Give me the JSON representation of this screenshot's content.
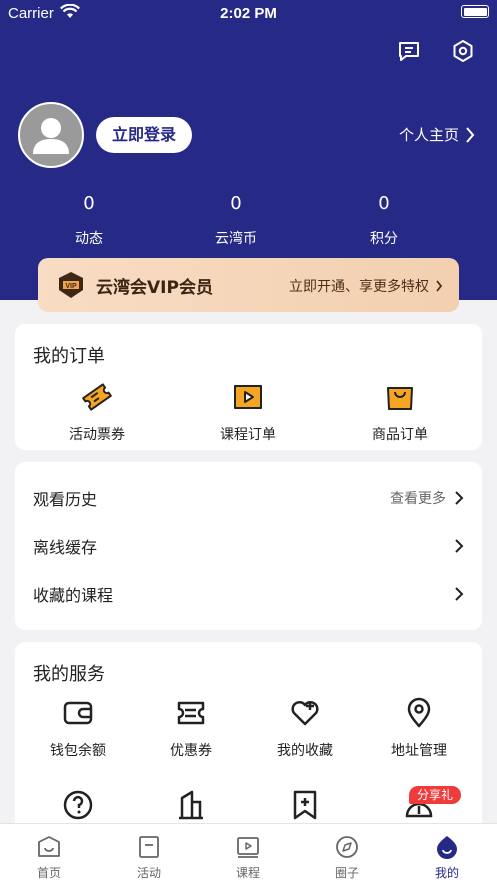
{
  "status_bar": {
    "carrier": "Carrier",
    "time": "2:02 PM"
  },
  "header": {
    "login_label": "立即登录",
    "profile_label": "个人主页",
    "stats": [
      {
        "value": "0",
        "label": "动态"
      },
      {
        "value": "0",
        "label": "云湾币"
      },
      {
        "value": "0",
        "label": "积分"
      }
    ]
  },
  "vip": {
    "badge": "VIP",
    "title": "云湾会VIP会员",
    "action": "立即开通、享更多特权"
  },
  "orders": {
    "title": "我的订单",
    "items": [
      {
        "label": "活动票券",
        "icon": "ticket-icon"
      },
      {
        "label": "课程订单",
        "icon": "course-order-icon"
      },
      {
        "label": "商品订单",
        "icon": "bag-icon"
      }
    ]
  },
  "history": {
    "rows": [
      {
        "label": "观看历史",
        "more": "查看更多"
      },
      {
        "label": "离线缓存"
      },
      {
        "label": "收藏的课程"
      }
    ]
  },
  "services": {
    "title": "我的服务",
    "items": [
      {
        "label": "钱包余额",
        "icon": "wallet-icon"
      },
      {
        "label": "优惠券",
        "icon": "coupon-icon"
      },
      {
        "label": "我的收藏",
        "icon": "heart-plus-icon"
      },
      {
        "label": "地址管理",
        "icon": "location-pin-icon"
      }
    ],
    "share_badge": "分享礼"
  },
  "tabbar": {
    "tabs": [
      {
        "label": "首页"
      },
      {
        "label": "活动"
      },
      {
        "label": "课程"
      },
      {
        "label": "圈子"
      },
      {
        "label": "我的",
        "active": true
      }
    ]
  },
  "colors": {
    "brand": "#262a86",
    "accent": "#f4a623",
    "badge": "#ef3b3b",
    "vip_bg": "#f4d5b8"
  }
}
